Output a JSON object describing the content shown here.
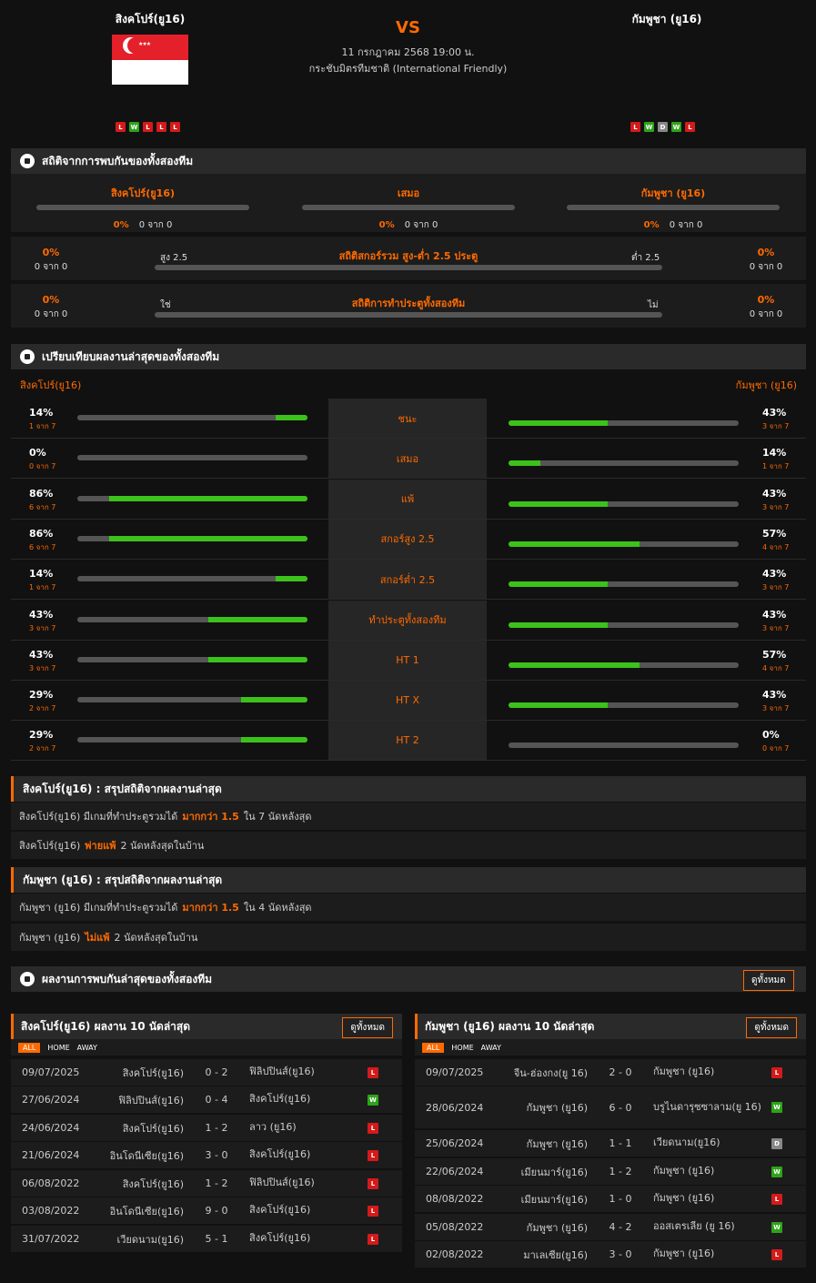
{
  "match": {
    "home": "สิงคโปร์(ยู16)",
    "away": "กัมพูชา (ยู16)",
    "vs": "VS",
    "date": "11 กรกฎาคม 2568 19:00 น.",
    "competition": "กระชับมิตรทีมชาติ (International Friendly)",
    "home_form": [
      "L",
      "W",
      "L",
      "L",
      "L"
    ],
    "away_form": [
      "L",
      "W",
      "D",
      "W",
      "L"
    ]
  },
  "h2h": {
    "title": "สถิติจากการพบกันของทั้งสองทีม",
    "cols": [
      {
        "label": "สิงคโปร์(ยู16)",
        "pct": "0%",
        "count": "0 จาก 0"
      },
      {
        "label": "เสมอ",
        "pct": "0%",
        "count": "0 จาก 0"
      },
      {
        "label": "กัมพูชา (ยู16)",
        "pct": "0%",
        "count": "0 จาก 0"
      }
    ],
    "ou": {
      "label": "สถิติสกอร์รวม สูง-ต่ำ 2.5 ประตู",
      "left_tag": "สูง 2.5",
      "right_tag": "ต่ำ 2.5",
      "left_pct": "0%",
      "left_count": "0 จาก 0",
      "right_pct": "0%",
      "right_count": "0 จาก 0"
    },
    "btts": {
      "label": "สถิติการทำประตูทั้งสองทีม",
      "left_tag": "ใช่",
      "right_tag": "ไม่",
      "left_pct": "0%",
      "left_count": "0 จาก 0",
      "right_pct": "0%",
      "right_count": "0 จาก 0"
    }
  },
  "compare": {
    "title": "เปรียบเทียบผลงานล่าสุดของทั้งสองทีม",
    "home": "สิงคโปร์(ยู16)",
    "away": "กัมพูชา (ยู16)",
    "rows": [
      {
        "label": "ชนะ",
        "hp": "14%",
        "hc": "1 จาก 7",
        "hv": 0.14,
        "ap": "43%",
        "ac": "3 จาก 7",
        "av": 0.43
      },
      {
        "label": "เสมอ",
        "hp": "0%",
        "hc": "0 จาก 7",
        "hv": 0,
        "ap": "14%",
        "ac": "1 จาก 7",
        "av": 0.14
      },
      {
        "label": "แพ้",
        "hp": "86%",
        "hc": "6 จาก 7",
        "hv": 0.86,
        "ap": "43%",
        "ac": "3 จาก 7",
        "av": 0.43
      },
      {
        "label": "สกอร์สูง 2.5",
        "hp": "86%",
        "hc": "6 จาก 7",
        "hv": 0.86,
        "ap": "57%",
        "ac": "4 จาก 7",
        "av": 0.57
      },
      {
        "label": "สกอร์ต่ำ 2.5",
        "hp": "14%",
        "hc": "1 จาก 7",
        "hv": 0.14,
        "ap": "43%",
        "ac": "3 จาก 7",
        "av": 0.43
      },
      {
        "label": "ทำประตูทั้งสองทีม",
        "hp": "43%",
        "hc": "3 จาก 7",
        "hv": 0.43,
        "ap": "43%",
        "ac": "3 จาก 7",
        "av": 0.43
      },
      {
        "label": "HT 1",
        "hp": "43%",
        "hc": "3 จาก 7",
        "hv": 0.43,
        "ap": "57%",
        "ac": "4 จาก 7",
        "av": 0.57
      },
      {
        "label": "HT X",
        "hp": "29%",
        "hc": "2 จาก 7",
        "hv": 0.29,
        "ap": "43%",
        "ac": "3 จาก 7",
        "av": 0.43
      },
      {
        "label": "HT 2",
        "hp": "29%",
        "hc": "2 จาก 7",
        "hv": 0.29,
        "ap": "0%",
        "ac": "0 จาก 7",
        "av": 0
      }
    ]
  },
  "summary_home": {
    "title": "สิงคโปร์(ยู16) : สรุปสถิติจากผลงานล่าสุด",
    "l1a": "สิงคโปร์(ยู16) มีเกมที่ทำประตูรวมได้",
    "l1b": "มากกว่า 1.5",
    "l1c": "ใน 7 นัดหลังสุด",
    "l2a": "สิงคโปร์(ยู16)",
    "l2b": "พ่ายแพ้",
    "l2c": "2 นัดหลังสุดในบ้าน"
  },
  "summary_away": {
    "title": "กัมพูชา (ยู16) : สรุปสถิติจากผลงานล่าสุด",
    "l1a": "กัมพูชา (ยู16) มีเกมที่ทำประตูรวมได้",
    "l1b": "มากกว่า 1.5",
    "l1c": "ใน 4 นัดหลังสุด",
    "l2a": "กัมพูชา (ยู16)",
    "l2b": "ไม่แพ้",
    "l2c": "2 นัดหลังสุดในบ้าน"
  },
  "recent_h2h": {
    "title": "ผลงานการพบกันล่าสุดของทั้งสองทีม",
    "btn": "ดูทั้งหมด"
  },
  "last10_home": {
    "title": "สิงคโปร์(ยู16) ผลงาน 10 นัดล่าสุด",
    "btn": "ดูทั้งหมด",
    "tabs": [
      "ALL",
      "HOME",
      "AWAY"
    ],
    "rows": [
      {
        "date": "09/07/2025",
        "home": "สิงคโปร์(ยู16)",
        "score": "0 - 2",
        "away": "ฟิลิปปินส์(ยู16)",
        "res": "L"
      },
      {
        "date": "27/06/2024",
        "home": "ฟิลิปปินส์(ยู16)",
        "score": "0 - 4",
        "away": "สิงคโปร์(ยู16)",
        "res": "W"
      },
      {
        "date": "24/06/2024",
        "home": "สิงคโปร์(ยู16)",
        "score": "1 - 2",
        "away": "ลาว (ยู16)",
        "res": "L"
      },
      {
        "date": "21/06/2024",
        "home": "อินโดนีเซีย(ยู16)",
        "score": "3 - 0",
        "away": "สิงคโปร์(ยู16)",
        "res": "L"
      },
      {
        "date": "06/08/2022",
        "home": "สิงคโปร์(ยู16)",
        "score": "1 - 2",
        "away": "ฟิลิปปินส์(ยู16)",
        "res": "L"
      },
      {
        "date": "03/08/2022",
        "home": "อินโดนีเซีย(ยู16)",
        "score": "9 - 0",
        "away": "สิงคโปร์(ยู16)",
        "res": "L"
      },
      {
        "date": "31/07/2022",
        "home": "เวียดนาม(ยู16)",
        "score": "5 - 1",
        "away": "สิงคโปร์(ยู16)",
        "res": "L"
      }
    ]
  },
  "last10_away": {
    "title": "กัมพูชา (ยู16) ผลงาน 10 นัดล่าสุด",
    "btn": "ดูทั้งหมด",
    "tabs": [
      "ALL",
      "HOME",
      "AWAY"
    ],
    "rows": [
      {
        "date": "09/07/2025",
        "home": "จีน-ฮ่องกง(ยู 16)",
        "score": "2 - 0",
        "away": "กัมพูชา (ยู16)",
        "res": "L"
      },
      {
        "date": "28/06/2024",
        "home": "กัมพูชา (ยู16)",
        "score": "6 - 0",
        "away": "บรูไนดารุซซาลาม(ยู 16)",
        "res": "W"
      },
      {
        "date": "25/06/2024",
        "home": "กัมพูชา (ยู16)",
        "score": "1 - 1",
        "away": "เวียดนาม(ยู16)",
        "res": "D"
      },
      {
        "date": "22/06/2024",
        "home": "เมียนมาร์(ยู16)",
        "score": "1 - 2",
        "away": "กัมพูชา (ยู16)",
        "res": "W"
      },
      {
        "date": "08/08/2022",
        "home": "เมียนมาร์(ยู16)",
        "score": "1 - 0",
        "away": "กัมพูชา (ยู16)",
        "res": "L"
      },
      {
        "date": "05/08/2022",
        "home": "กัมพูชา (ยู16)",
        "score": "4 - 2",
        "away": "ออสเตรเลีย (ยู 16)",
        "res": "W"
      },
      {
        "date": "02/08/2022",
        "home": "มาเลเซีย(ยู16)",
        "score": "3 - 0",
        "away": "กัมพูชา (ยู16)",
        "res": "L"
      }
    ]
  },
  "colors": {
    "accent": "#ff6a00",
    "bar_green": "#3cc21a",
    "win": "#2ea31a",
    "loss": "#d41a1a",
    "draw": "#888888"
  }
}
